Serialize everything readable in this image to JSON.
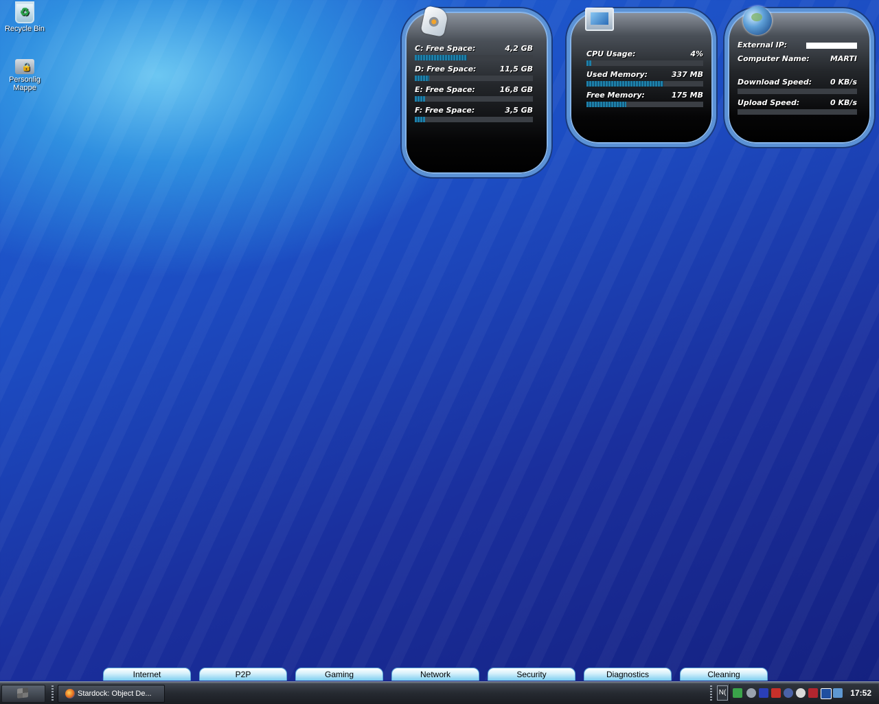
{
  "desktop": {
    "icons": [
      {
        "label": "Recycle Bin"
      },
      {
        "label": "Personlig\nMappe"
      }
    ]
  },
  "widgets": {
    "drives": {
      "rows": [
        {
          "label": "C: Free Space:",
          "value": "4,2 GB",
          "fill": 0.44
        },
        {
          "label": "D: Free Space:",
          "value": "11,5 GB",
          "fill": 0.12
        },
        {
          "label": "E: Free Space:",
          "value": "16,8 GB",
          "fill": 0.09
        },
        {
          "label": "F: Free Space:",
          "value": "3,5 GB",
          "fill": 0.09
        }
      ]
    },
    "system": {
      "rows": [
        {
          "label": "CPU Usage:",
          "value": "4%",
          "fill": 0.04
        },
        {
          "label": "Used Memory:",
          "value": "337 MB",
          "fill": 0.66
        },
        {
          "label": "Free Memory:",
          "value": "175 MB",
          "fill": 0.34
        }
      ]
    },
    "network": {
      "external_ip_label": "External IP:",
      "computer_name_label": "Computer Name:",
      "computer_name": "MARTI",
      "download_label": "Download Speed:",
      "download_value": "0 KB/s",
      "upload_label": "Upload Speed:",
      "upload_value": "0 KB/s"
    }
  },
  "categories": [
    "Internet",
    "P2P",
    "Gaming",
    "Network",
    "Security",
    "Diagnostics",
    "Cleaning"
  ],
  "taskbar": {
    "task_label": "Stardock: Object De...",
    "lang": "N(",
    "clock": "17:52"
  }
}
